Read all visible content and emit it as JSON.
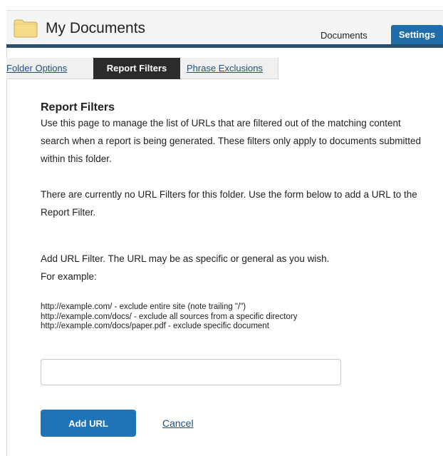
{
  "header": {
    "title": "My Documents",
    "tabs": [
      {
        "label": "Documents"
      },
      {
        "label": "Settings"
      }
    ],
    "folder_icon": "folder-icon"
  },
  "subtabs": [
    {
      "label": "Folder Options"
    },
    {
      "label": "Report Filters"
    },
    {
      "label": "Phrase Exclusions"
    }
  ],
  "content": {
    "title": "Report Filters",
    "paragraph1": "Use this page to manage the list of URLs that are filtered out of the matching content search when a report is being generated. These filters only apply to documents submitted within this folder.",
    "paragraph2": "There are currently no URL Filters for this folder. Use the form below to add a URL to the Report Filter.",
    "paragraph3_line1": "Add URL Filter. The URL may be as specific or general as you wish.",
    "paragraph3_line2": "For example:",
    "examples": [
      "http://example.com/ - exclude entire site (note trailing \"/\")",
      "http://example.com/docs/ - exclude all sources from a specific directory",
      "http://example.com/docs/paper.pdf - exclude specific document"
    ],
    "url_input_value": "",
    "add_button_label": "Add URL",
    "cancel_label": "Cancel"
  },
  "colors": {
    "accent": "#1f74b8",
    "bar": "#2a4f6e",
    "active_subtab": "#2b2b2b",
    "folder": "#f5dc8a"
  }
}
